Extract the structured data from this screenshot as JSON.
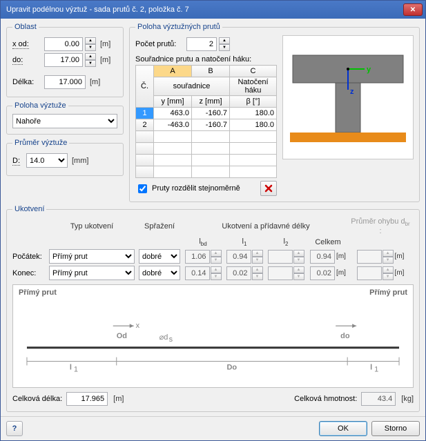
{
  "window": {
    "title": "Upravit podélnou výztuž - sada prutů č. 2, položka č. 7"
  },
  "oblast": {
    "legend": "Oblast",
    "x_od_label": "x od:",
    "x_od": "0.00",
    "x_od_unit": "[m]",
    "do_label": "do:",
    "do": "17.00",
    "do_unit": "[m]",
    "delka_label": "Délka:",
    "delka": "17.000",
    "delka_unit": "[m]"
  },
  "poloha_v": {
    "legend": "Poloha výztuže",
    "options": [
      "Nahoře"
    ],
    "selected": "Nahoře"
  },
  "prumer": {
    "legend": "Průměr výztuže",
    "d_label": "D:",
    "d_value": "14.0",
    "d_unit": "[mm]"
  },
  "poloha_prutu": {
    "legend": "Poloha výztužných prutů",
    "pocet_label": "Počet prutů:",
    "pocet": "2",
    "sour_label": "Souřadnice prutu a natočení háku:",
    "cols": {
      "c": "Č.",
      "a": "A",
      "b": "B",
      "cc": "C",
      "sour": "souřadnice",
      "nat": "Natočení háku",
      "y": "y [mm]",
      "z": "z [mm]",
      "beta": "β [°]"
    },
    "rows": [
      {
        "n": "1",
        "y": "463.0",
        "z": "-160.7",
        "b": "180.0"
      },
      {
        "n": "2",
        "y": "-463.0",
        "z": "-160.7",
        "b": "180.0"
      }
    ],
    "chk_label": "Pruty rozdělit stejnoměrně",
    "chk": true
  },
  "ukotveni": {
    "legend": "Ukotvení",
    "typ_hdr": "Typ ukotvení",
    "spr_hdr": "Spřažení",
    "group_hdr": "Ukotvení a přídavné délky",
    "lbd_hdr": "lbd",
    "l1_hdr": "l1",
    "l2_hdr": "l2",
    "celkem_hdr": "Celkem",
    "prumer_hdr": "Průměr ohybu dbr :",
    "pocatek_label": "Počátek:",
    "konec_label": "Konec:",
    "typ_options": [
      "Přímý prut"
    ],
    "spr_options": [
      "dobré"
    ],
    "p": {
      "typ": "Přímý prut",
      "spr": "dobré",
      "lbd": "1.06",
      "l1": "0.94",
      "l2": "",
      "cel": "0.94",
      "dbr": ""
    },
    "k": {
      "typ": "Přímý prut",
      "spr": "dobré",
      "lbd": "0.14",
      "l1": "0.02",
      "l2": "",
      "cel": "0.02",
      "dbr": ""
    },
    "unit": "[m]"
  },
  "diagram": {
    "left_label": "Přímý prut",
    "right_label": "Přímý prut",
    "od": "Od",
    "do": "do",
    "Do": "Do",
    "l1": "l1",
    "ds": "⌀ds",
    "x": "x"
  },
  "footer": {
    "cd_label": "Celková délka:",
    "cd": "17.965",
    "cd_unit": "[m]",
    "ch_label": "Celková hmotnost:",
    "ch": "43.4",
    "ch_unit": "[kg]"
  },
  "buttons": {
    "ok": "OK",
    "storno": "Storno"
  }
}
